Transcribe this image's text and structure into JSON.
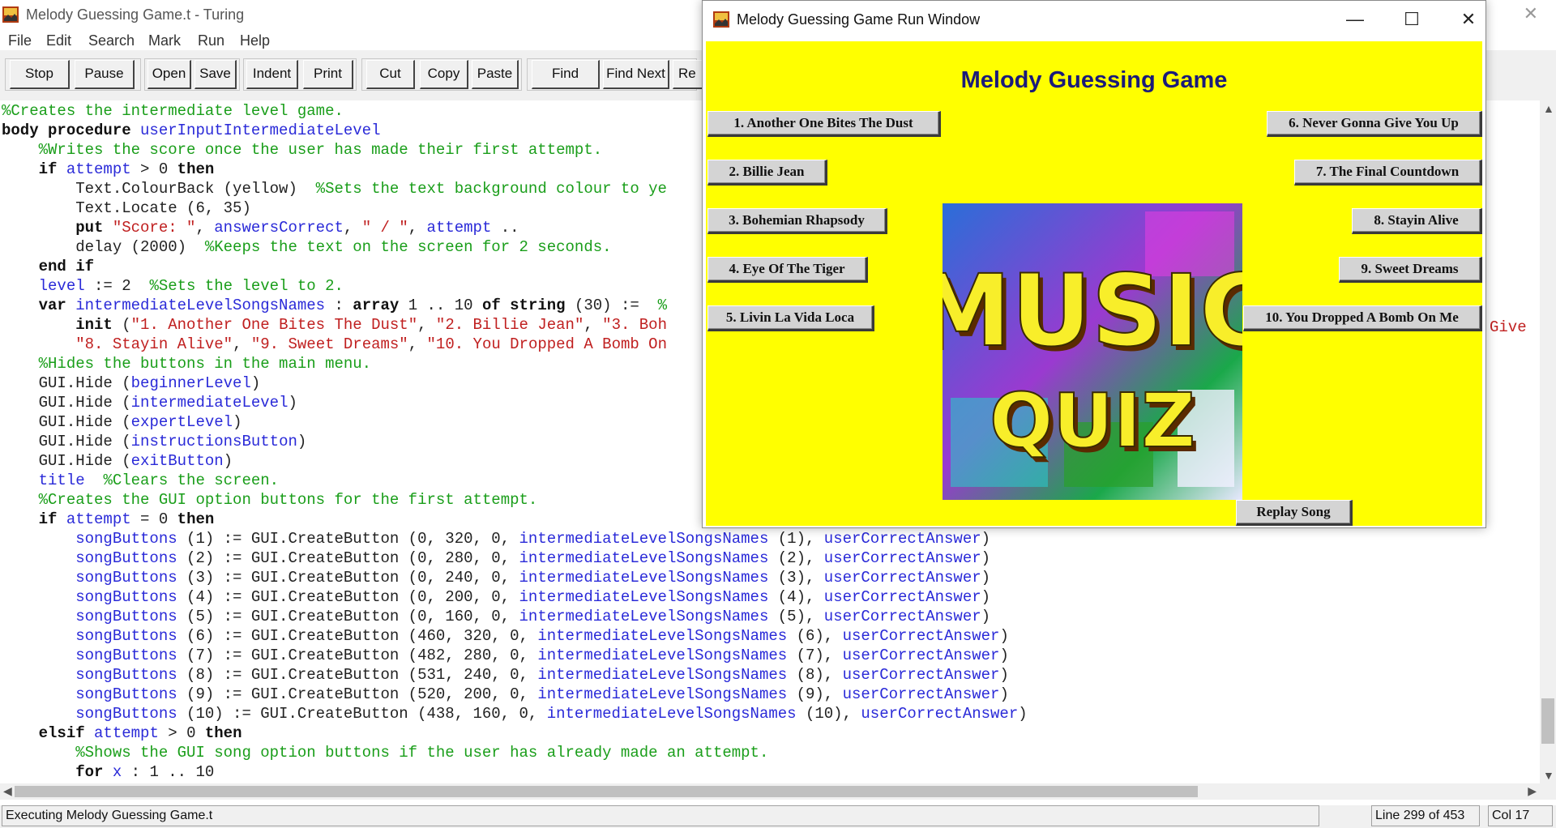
{
  "editor": {
    "title": "Melody Guessing Game.t - Turing",
    "menu": [
      "File",
      "Edit",
      "Search",
      "Mark",
      "Run",
      "Help"
    ],
    "toolbar": [
      "Stop",
      "Pause",
      "Open",
      "Save",
      "Indent",
      "Print",
      "Cut",
      "Copy",
      "Paste",
      "Find",
      "Find Next",
      "Re"
    ],
    "status": {
      "message": "Executing Melody Guessing Game.t",
      "line": "Line 299 of 453",
      "col": "Col 17"
    }
  },
  "code_lines": [
    [
      [
        "c",
        "%Creates the intermediate level game."
      ]
    ],
    [
      [
        "k",
        "body procedure "
      ],
      [
        "v",
        "userInputIntermediateLevel"
      ]
    ],
    [
      [
        "t",
        "    "
      ],
      [
        "c",
        "%Writes the score once the user has made their first attempt."
      ]
    ],
    [
      [
        "t",
        "    "
      ],
      [
        "k",
        "if "
      ],
      [
        "v",
        "attempt"
      ],
      [
        "t",
        " > 0 "
      ],
      [
        "k",
        "then"
      ]
    ],
    [
      [
        "t",
        "        Text.ColourBack (yellow)  "
      ],
      [
        "c",
        "%Sets the text background colour to ye"
      ]
    ],
    [
      [
        "t",
        "        Text.Locate (6, 35)"
      ]
    ],
    [
      [
        "t",
        "        "
      ],
      [
        "k",
        "put "
      ],
      [
        "s",
        "\"Score: \""
      ],
      [
        "t",
        ", "
      ],
      [
        "v",
        "answersCorrect"
      ],
      [
        "t",
        ", "
      ],
      [
        "s",
        "\" / \""
      ],
      [
        "t",
        ", "
      ],
      [
        "v",
        "attempt"
      ],
      [
        "t",
        " .."
      ]
    ],
    [
      [
        "t",
        "        delay (2000)  "
      ],
      [
        "c",
        "%Keeps the text on the screen for 2 seconds."
      ]
    ],
    [
      [
        "t",
        "    "
      ],
      [
        "k",
        "end if"
      ]
    ],
    [
      [
        "t",
        "    "
      ],
      [
        "v",
        "level"
      ],
      [
        "t",
        " := 2  "
      ],
      [
        "c",
        "%Sets the level to 2."
      ]
    ],
    [
      [
        "t",
        "    "
      ],
      [
        "k",
        "var "
      ],
      [
        "v",
        "intermediateLevelSongsNames"
      ],
      [
        "t",
        " : "
      ],
      [
        "k",
        "array"
      ],
      [
        "t",
        " 1 .. 10 "
      ],
      [
        "k",
        "of string"
      ],
      [
        "t",
        " (30) :=  "
      ],
      [
        "c",
        "%"
      ]
    ],
    [
      [
        "t",
        "        "
      ],
      [
        "k",
        "init"
      ],
      [
        "t",
        " ("
      ],
      [
        "s",
        "\"1. Another One Bites The Dust\""
      ],
      [
        "t",
        ", "
      ],
      [
        "s",
        "\"2. Billie Jean\""
      ],
      [
        "t",
        ", "
      ],
      [
        "s",
        "\"3. Boh"
      ]
    ],
    [
      [
        "t",
        "        "
      ],
      [
        "s",
        "\"8. Stayin Alive\""
      ],
      [
        "t",
        ", "
      ],
      [
        "s",
        "\"9. Sweet Dreams\""
      ],
      [
        "t",
        ", "
      ],
      [
        "s",
        "\"10. You Dropped A Bomb On"
      ]
    ],
    [
      [
        "t",
        "    "
      ],
      [
        "c",
        "%Hides the buttons in the main menu."
      ]
    ],
    [
      [
        "t",
        "    GUI.Hide ("
      ],
      [
        "v",
        "beginnerLevel"
      ],
      [
        "t",
        ")"
      ]
    ],
    [
      [
        "t",
        "    GUI.Hide ("
      ],
      [
        "v",
        "intermediateLevel"
      ],
      [
        "t",
        ")"
      ]
    ],
    [
      [
        "t",
        "    GUI.Hide ("
      ],
      [
        "v",
        "expertLevel"
      ],
      [
        "t",
        ")"
      ]
    ],
    [
      [
        "t",
        "    GUI.Hide ("
      ],
      [
        "v",
        "instructionsButton"
      ],
      [
        "t",
        ")"
      ]
    ],
    [
      [
        "t",
        "    GUI.Hide ("
      ],
      [
        "v",
        "exitButton"
      ],
      [
        "t",
        ")"
      ]
    ],
    [
      [
        "t",
        "    "
      ],
      [
        "v",
        "title"
      ],
      [
        "t",
        "  "
      ],
      [
        "c",
        "%Clears the screen."
      ]
    ],
    [
      [
        "t",
        "    "
      ],
      [
        "c",
        "%Creates the GUI option buttons for the first attempt."
      ]
    ],
    [
      [
        "t",
        "    "
      ],
      [
        "k",
        "if "
      ],
      [
        "v",
        "attempt"
      ],
      [
        "t",
        " = 0 "
      ],
      [
        "k",
        "then"
      ]
    ],
    [
      [
        "t",
        "        "
      ],
      [
        "v",
        "songButtons"
      ],
      [
        "t",
        " (1) := GUI.CreateButton (0, 320, 0, "
      ],
      [
        "v",
        "intermediateLevelSongsNames"
      ],
      [
        "t",
        " (1), "
      ],
      [
        "v",
        "userCorrectAnswer"
      ],
      [
        "t",
        ")"
      ]
    ],
    [
      [
        "t",
        "        "
      ],
      [
        "v",
        "songButtons"
      ],
      [
        "t",
        " (2) := GUI.CreateButton (0, 280, 0, "
      ],
      [
        "v",
        "intermediateLevelSongsNames"
      ],
      [
        "t",
        " (2), "
      ],
      [
        "v",
        "userCorrectAnswer"
      ],
      [
        "t",
        ")"
      ]
    ],
    [
      [
        "t",
        "        "
      ],
      [
        "v",
        "songButtons"
      ],
      [
        "t",
        " (3) := GUI.CreateButton (0, 240, 0, "
      ],
      [
        "v",
        "intermediateLevelSongsNames"
      ],
      [
        "t",
        " (3), "
      ],
      [
        "v",
        "userCorrectAnswer"
      ],
      [
        "t",
        ")"
      ]
    ],
    [
      [
        "t",
        "        "
      ],
      [
        "v",
        "songButtons"
      ],
      [
        "t",
        " (4) := GUI.CreateButton (0, 200, 0, "
      ],
      [
        "v",
        "intermediateLevelSongsNames"
      ],
      [
        "t",
        " (4), "
      ],
      [
        "v",
        "userCorrectAnswer"
      ],
      [
        "t",
        ")"
      ]
    ],
    [
      [
        "t",
        "        "
      ],
      [
        "v",
        "songButtons"
      ],
      [
        "t",
        " (5) := GUI.CreateButton (0, 160, 0, "
      ],
      [
        "v",
        "intermediateLevelSongsNames"
      ],
      [
        "t",
        " (5), "
      ],
      [
        "v",
        "userCorrectAnswer"
      ],
      [
        "t",
        ")"
      ]
    ],
    [
      [
        "t",
        "        "
      ],
      [
        "v",
        "songButtons"
      ],
      [
        "t",
        " (6) := GUI.CreateButton (460, 320, 0, "
      ],
      [
        "v",
        "intermediateLevelSongsNames"
      ],
      [
        "t",
        " (6), "
      ],
      [
        "v",
        "userCorrectAnswer"
      ],
      [
        "t",
        ")"
      ]
    ],
    [
      [
        "t",
        "        "
      ],
      [
        "v",
        "songButtons"
      ],
      [
        "t",
        " (7) := GUI.CreateButton (482, 280, 0, "
      ],
      [
        "v",
        "intermediateLevelSongsNames"
      ],
      [
        "t",
        " (7), "
      ],
      [
        "v",
        "userCorrectAnswer"
      ],
      [
        "t",
        ")"
      ]
    ],
    [
      [
        "t",
        "        "
      ],
      [
        "v",
        "songButtons"
      ],
      [
        "t",
        " (8) := GUI.CreateButton (531, 240, 0, "
      ],
      [
        "v",
        "intermediateLevelSongsNames"
      ],
      [
        "t",
        " (8), "
      ],
      [
        "v",
        "userCorrectAnswer"
      ],
      [
        "t",
        ")"
      ]
    ],
    [
      [
        "t",
        "        "
      ],
      [
        "v",
        "songButtons"
      ],
      [
        "t",
        " (9) := GUI.CreateButton (520, 200, 0, "
      ],
      [
        "v",
        "intermediateLevelSongsNames"
      ],
      [
        "t",
        " (9), "
      ],
      [
        "v",
        "userCorrectAnswer"
      ],
      [
        "t",
        ")"
      ]
    ],
    [
      [
        "t",
        "        "
      ],
      [
        "v",
        "songButtons"
      ],
      [
        "t",
        " (10) := GUI.CreateButton (438, 160, 0, "
      ],
      [
        "v",
        "intermediateLevelSongsNames"
      ],
      [
        "t",
        " (10), "
      ],
      [
        "v",
        "userCorrectAnswer"
      ],
      [
        "t",
        ")"
      ]
    ],
    [
      [
        "t",
        "    "
      ],
      [
        "k",
        "elsif "
      ],
      [
        "v",
        "attempt"
      ],
      [
        "t",
        " > 0 "
      ],
      [
        "k",
        "then"
      ]
    ],
    [
      [
        "t",
        "        "
      ],
      [
        "c",
        "%Shows the GUI song option buttons if the user has already made an attempt."
      ]
    ],
    [
      [
        "t",
        "        "
      ],
      [
        "k",
        "for "
      ],
      [
        "v",
        "x"
      ],
      [
        "t",
        " : 1 .. 10"
      ]
    ]
  ],
  "code_overflow_right": [
    "Give"
  ],
  "run_window": {
    "title": "Melody Guessing Game Run Window",
    "game_title": "Melody Guessing Game",
    "songs_left": [
      "1. Another One Bites The Dust",
      "2. Billie Jean",
      "3. Bohemian Rhapsody",
      "4. Eye Of The Tiger",
      "5. Livin La Vida Loca"
    ],
    "songs_right": [
      "6. Never Gonna Give You Up",
      "7. The Final Countdown",
      "8. Stayin Alive",
      "9. Sweet Dreams",
      "10. You Dropped A Bomb On Me"
    ],
    "replay_label": "Replay Song",
    "logo_line1": "MUSIC",
    "logo_line2": "QUIZ"
  },
  "colors": {
    "canvas": "#ffff00",
    "comment": "#1a9e1a",
    "identifier": "#2a2ad8",
    "string": "#c02020",
    "title": "#1a1a7a"
  }
}
